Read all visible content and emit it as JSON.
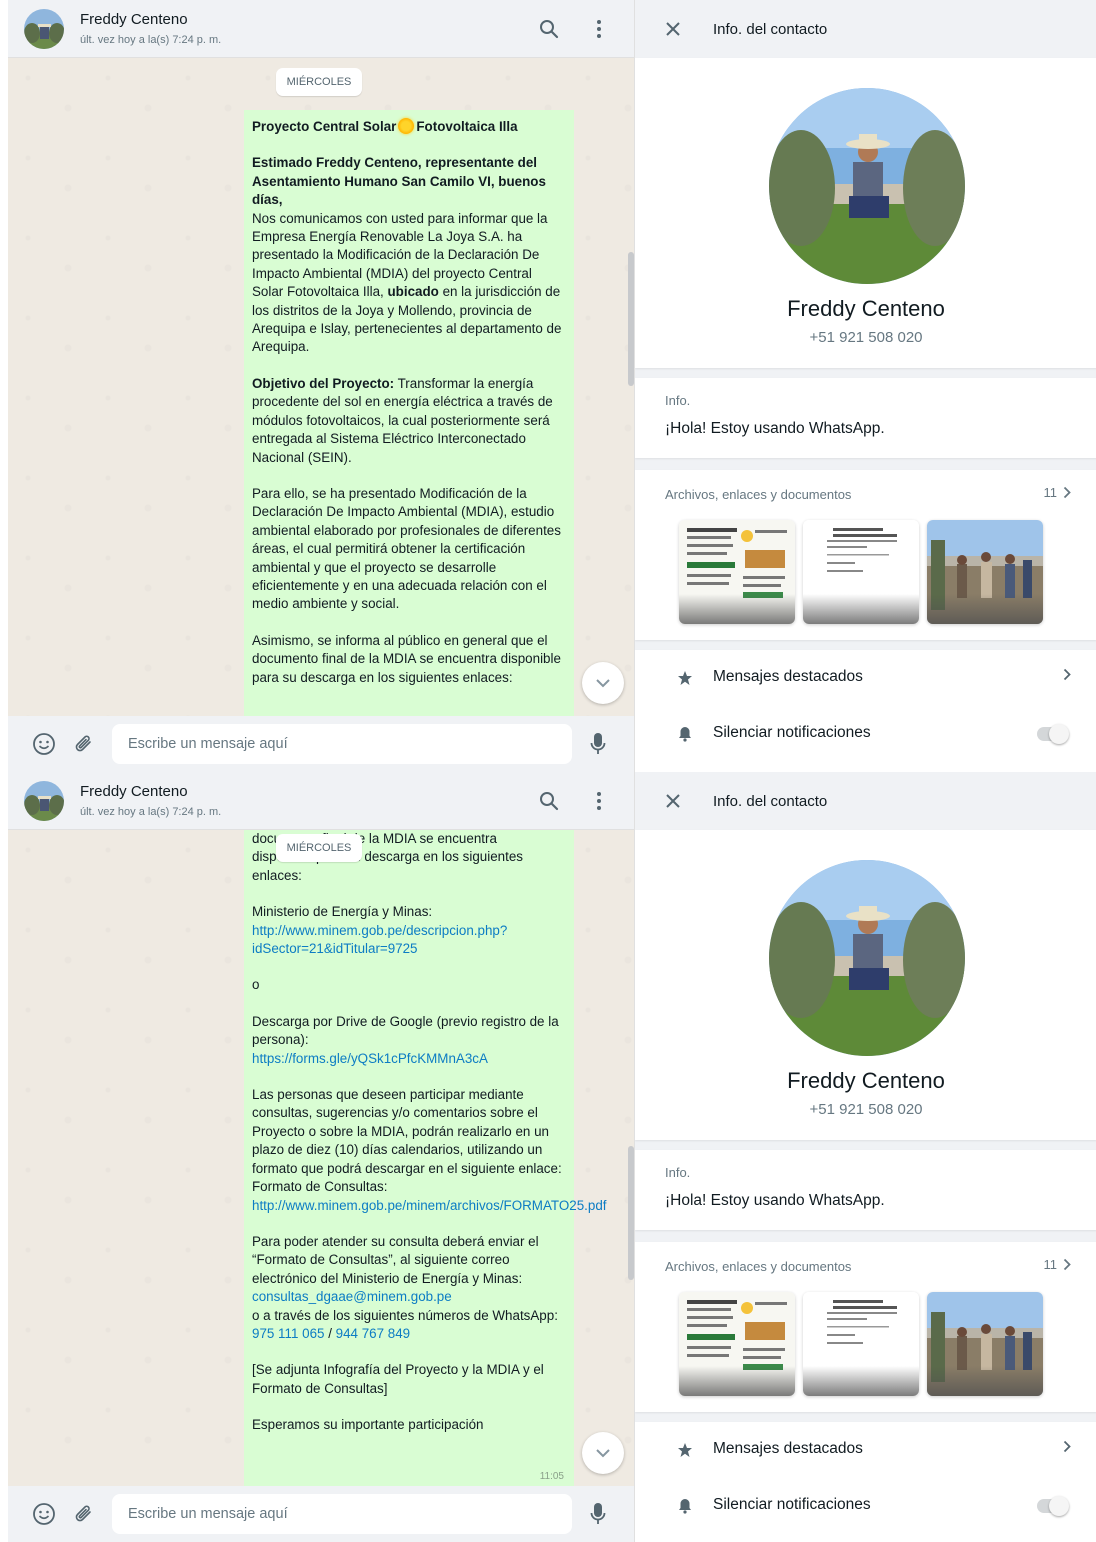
{
  "chat": {
    "contact_name": "Freddy Centeno",
    "last_seen": "últ. vez hoy a la(s) 7:24 p. m.",
    "date_chip": "MIÉRCOLES",
    "input_placeholder": "Escribe un mensaje aquí",
    "message_part1": {
      "title_a": "Proyecto Central Solar",
      "title_b": "Fotovoltaica Illa",
      "greeting": "Estimado Freddy Centeno, representante del Asentamiento Humano San Camilo VI, buenos días,",
      "intro_a": "Nos comunicamos con usted para informar que la Empresa Energía Renovable La Joya S.A. ha presentado la Modificación de la Declaración De Impacto Ambiental (MDIA) del proyecto Central Solar Fotovoltaica Illa,",
      "intro_bold": "ubicado",
      "intro_b": "en la jurisdicción de los distritos de la Joya y Mollendo, provincia de Arequipa e Islay, pertenecientes al departamento de Arequipa.",
      "objective_label": "Objetivo del Proyecto:",
      "objective_text": "Transformar la energía procedente del sol en energía eléctrica a través de módulos fotovoltaicos, la cual posteriormente será entregada al Sistema Eléctrico Interconectado Nacional (SEIN).",
      "para_mdia": "Para ello, se ha presentado Modificación de la Declaración De Impacto Ambiental (MDIA), estudio ambiental elaborado por profesionales de diferentes áreas, el cual permitirá obtener la certificación ambiental y que el proyecto se desarrolle eficientemente y en una adecuada relación con el medio ambiente y social.",
      "para_public": "Asimismo, se informa al público en general que el documento final de la MDIA se encuentra disponible para su descarga en los siguientes enlaces:"
    },
    "message_part2": {
      "cut_line": "documento final de la MDIA se encuentra",
      "cut_line2": "disponible para su descarga en los siguientes enlaces:",
      "minem_label": "Ministerio de Energía y Minas:",
      "minem_link": "http://www.minem.gob.pe/descripcion.php?idSector=21&idTitular=9725",
      "or": "o",
      "drive_label": "Descarga por Drive de Google (previo registro de la persona):",
      "drive_link": "https://forms.gle/yQSk1cPfcKMMnA3cA",
      "participate": "Las personas que deseen participar mediante consultas, sugerencias y/o comentarios sobre el Proyecto o sobre la MDIA, podrán realizarlo en un plazo de diez (10) días calendarios, utilizando un formato que podrá descargar en el siguiente enlace:",
      "format_label": "Formato de Consultas:",
      "format_link": "http://www.minem.gob.pe/minem/archivos/FORMATO25.pdf",
      "attend": "Para poder atender su consulta deberá enviar el “Formato de Consultas”, al siguiente correo electrónico del Ministerio de Energía y Minas:",
      "email": "consultas_dgaae@minem.gob.pe",
      "whatsapp_text": "o a través de los siguientes números de WhatsApp:",
      "phone1": "975 111 065",
      "phone_sep": " / ",
      "phone2": "944 767 849",
      "attachment": "[Se adjunta Infografía del Proyecto y la MDIA y el Formato de Consultas]",
      "closing": "Esperamos su importante participación",
      "time": "11:05"
    }
  },
  "info": {
    "title": "Info. del contacto",
    "name": "Freddy Centeno",
    "phone": "+51 921 508 020",
    "about_label": "Info.",
    "about_text": "¡Hola! Estoy usando WhatsApp.",
    "media_label": "Archivos, enlaces y documentos",
    "media_count": "11",
    "starred": "Mensajes destacados",
    "mute": "Silenciar notificaciones"
  },
  "colors": {
    "bubble": "#d9fdd3",
    "panel": "#f0f2f5",
    "link": "#0c7cc4"
  },
  "icons": [
    "search-icon",
    "menu-icon",
    "emoji-icon",
    "attach-icon",
    "mic-icon",
    "close-icon",
    "chevron-right-icon",
    "star-icon",
    "bell-icon",
    "chevron-down-icon"
  ]
}
